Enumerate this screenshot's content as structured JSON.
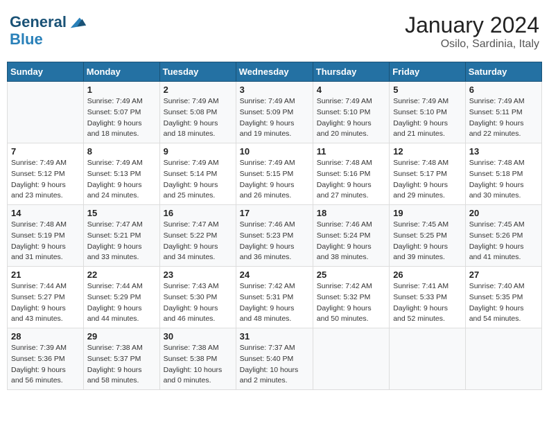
{
  "header": {
    "logo_line1": "General",
    "logo_line2": "Blue",
    "title": "January 2024",
    "subtitle": "Osilo, Sardinia, Italy"
  },
  "weekdays": [
    "Sunday",
    "Monday",
    "Tuesday",
    "Wednesday",
    "Thursday",
    "Friday",
    "Saturday"
  ],
  "weeks": [
    [
      {
        "day": "",
        "sunrise": "",
        "sunset": "",
        "daylight": ""
      },
      {
        "day": "1",
        "sunrise": "Sunrise: 7:49 AM",
        "sunset": "Sunset: 5:07 PM",
        "daylight": "Daylight: 9 hours and 18 minutes."
      },
      {
        "day": "2",
        "sunrise": "Sunrise: 7:49 AM",
        "sunset": "Sunset: 5:08 PM",
        "daylight": "Daylight: 9 hours and 18 minutes."
      },
      {
        "day": "3",
        "sunrise": "Sunrise: 7:49 AM",
        "sunset": "Sunset: 5:09 PM",
        "daylight": "Daylight: 9 hours and 19 minutes."
      },
      {
        "day": "4",
        "sunrise": "Sunrise: 7:49 AM",
        "sunset": "Sunset: 5:10 PM",
        "daylight": "Daylight: 9 hours and 20 minutes."
      },
      {
        "day": "5",
        "sunrise": "Sunrise: 7:49 AM",
        "sunset": "Sunset: 5:10 PM",
        "daylight": "Daylight: 9 hours and 21 minutes."
      },
      {
        "day": "6",
        "sunrise": "Sunrise: 7:49 AM",
        "sunset": "Sunset: 5:11 PM",
        "daylight": "Daylight: 9 hours and 22 minutes."
      }
    ],
    [
      {
        "day": "7",
        "sunrise": "Sunrise: 7:49 AM",
        "sunset": "Sunset: 5:12 PM",
        "daylight": "Daylight: 9 hours and 23 minutes."
      },
      {
        "day": "8",
        "sunrise": "Sunrise: 7:49 AM",
        "sunset": "Sunset: 5:13 PM",
        "daylight": "Daylight: 9 hours and 24 minutes."
      },
      {
        "day": "9",
        "sunrise": "Sunrise: 7:49 AM",
        "sunset": "Sunset: 5:14 PM",
        "daylight": "Daylight: 9 hours and 25 minutes."
      },
      {
        "day": "10",
        "sunrise": "Sunrise: 7:49 AM",
        "sunset": "Sunset: 5:15 PM",
        "daylight": "Daylight: 9 hours and 26 minutes."
      },
      {
        "day": "11",
        "sunrise": "Sunrise: 7:48 AM",
        "sunset": "Sunset: 5:16 PM",
        "daylight": "Daylight: 9 hours and 27 minutes."
      },
      {
        "day": "12",
        "sunrise": "Sunrise: 7:48 AM",
        "sunset": "Sunset: 5:17 PM",
        "daylight": "Daylight: 9 hours and 29 minutes."
      },
      {
        "day": "13",
        "sunrise": "Sunrise: 7:48 AM",
        "sunset": "Sunset: 5:18 PM",
        "daylight": "Daylight: 9 hours and 30 minutes."
      }
    ],
    [
      {
        "day": "14",
        "sunrise": "Sunrise: 7:48 AM",
        "sunset": "Sunset: 5:19 PM",
        "daylight": "Daylight: 9 hours and 31 minutes."
      },
      {
        "day": "15",
        "sunrise": "Sunrise: 7:47 AM",
        "sunset": "Sunset: 5:21 PM",
        "daylight": "Daylight: 9 hours and 33 minutes."
      },
      {
        "day": "16",
        "sunrise": "Sunrise: 7:47 AM",
        "sunset": "Sunset: 5:22 PM",
        "daylight": "Daylight: 9 hours and 34 minutes."
      },
      {
        "day": "17",
        "sunrise": "Sunrise: 7:46 AM",
        "sunset": "Sunset: 5:23 PM",
        "daylight": "Daylight: 9 hours and 36 minutes."
      },
      {
        "day": "18",
        "sunrise": "Sunrise: 7:46 AM",
        "sunset": "Sunset: 5:24 PM",
        "daylight": "Daylight: 9 hours and 38 minutes."
      },
      {
        "day": "19",
        "sunrise": "Sunrise: 7:45 AM",
        "sunset": "Sunset: 5:25 PM",
        "daylight": "Daylight: 9 hours and 39 minutes."
      },
      {
        "day": "20",
        "sunrise": "Sunrise: 7:45 AM",
        "sunset": "Sunset: 5:26 PM",
        "daylight": "Daylight: 9 hours and 41 minutes."
      }
    ],
    [
      {
        "day": "21",
        "sunrise": "Sunrise: 7:44 AM",
        "sunset": "Sunset: 5:27 PM",
        "daylight": "Daylight: 9 hours and 43 minutes."
      },
      {
        "day": "22",
        "sunrise": "Sunrise: 7:44 AM",
        "sunset": "Sunset: 5:29 PM",
        "daylight": "Daylight: 9 hours and 44 minutes."
      },
      {
        "day": "23",
        "sunrise": "Sunrise: 7:43 AM",
        "sunset": "Sunset: 5:30 PM",
        "daylight": "Daylight: 9 hours and 46 minutes."
      },
      {
        "day": "24",
        "sunrise": "Sunrise: 7:42 AM",
        "sunset": "Sunset: 5:31 PM",
        "daylight": "Daylight: 9 hours and 48 minutes."
      },
      {
        "day": "25",
        "sunrise": "Sunrise: 7:42 AM",
        "sunset": "Sunset: 5:32 PM",
        "daylight": "Daylight: 9 hours and 50 minutes."
      },
      {
        "day": "26",
        "sunrise": "Sunrise: 7:41 AM",
        "sunset": "Sunset: 5:33 PM",
        "daylight": "Daylight: 9 hours and 52 minutes."
      },
      {
        "day": "27",
        "sunrise": "Sunrise: 7:40 AM",
        "sunset": "Sunset: 5:35 PM",
        "daylight": "Daylight: 9 hours and 54 minutes."
      }
    ],
    [
      {
        "day": "28",
        "sunrise": "Sunrise: 7:39 AM",
        "sunset": "Sunset: 5:36 PM",
        "daylight": "Daylight: 9 hours and 56 minutes."
      },
      {
        "day": "29",
        "sunrise": "Sunrise: 7:38 AM",
        "sunset": "Sunset: 5:37 PM",
        "daylight": "Daylight: 9 hours and 58 minutes."
      },
      {
        "day": "30",
        "sunrise": "Sunrise: 7:38 AM",
        "sunset": "Sunset: 5:38 PM",
        "daylight": "Daylight: 10 hours and 0 minutes."
      },
      {
        "day": "31",
        "sunrise": "Sunrise: 7:37 AM",
        "sunset": "Sunset: 5:40 PM",
        "daylight": "Daylight: 10 hours and 2 minutes."
      },
      {
        "day": "",
        "sunrise": "",
        "sunset": "",
        "daylight": ""
      },
      {
        "day": "",
        "sunrise": "",
        "sunset": "",
        "daylight": ""
      },
      {
        "day": "",
        "sunrise": "",
        "sunset": "",
        "daylight": ""
      }
    ]
  ]
}
